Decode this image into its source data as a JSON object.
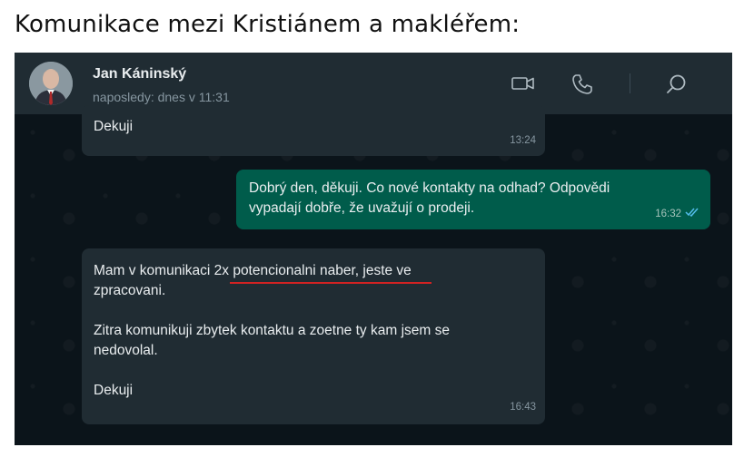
{
  "page_title": "Komunikace mezi Kristiánem a makléřem:",
  "header": {
    "contact_name": "Jan Káninský",
    "last_seen": "naposledy: dnes v 11:31",
    "icons": [
      "avatar",
      "video-call-icon",
      "phone-icon",
      "search-icon"
    ]
  },
  "messages": [
    {
      "direction": "in",
      "text": "Dekuji",
      "time": "13:24"
    },
    {
      "direction": "out",
      "text": "Dobrý den, děkuji. Co nové kontakty na odhad? Odpovědi\nvypadají dobře, že uvažují o prodeji.",
      "time": "16:32",
      "status": "read"
    },
    {
      "direction": "in",
      "text": "Mam v komunikaci 2x potencionalni naber, jeste ve\nzpracovani.\n\nZitra komunikuji zbytek kontaktu a zoetne ty kam jsem se\nnedovolal.\n\nDekuji",
      "time": "16:43"
    }
  ],
  "colors": {
    "chat_background": "#0b141a",
    "header_background": "#202c33",
    "incoming_bubble": "#202c33",
    "outgoing_bubble": "#005c4b",
    "read_ticks": "#53bdeb",
    "highlight_underline": "#d32222"
  }
}
